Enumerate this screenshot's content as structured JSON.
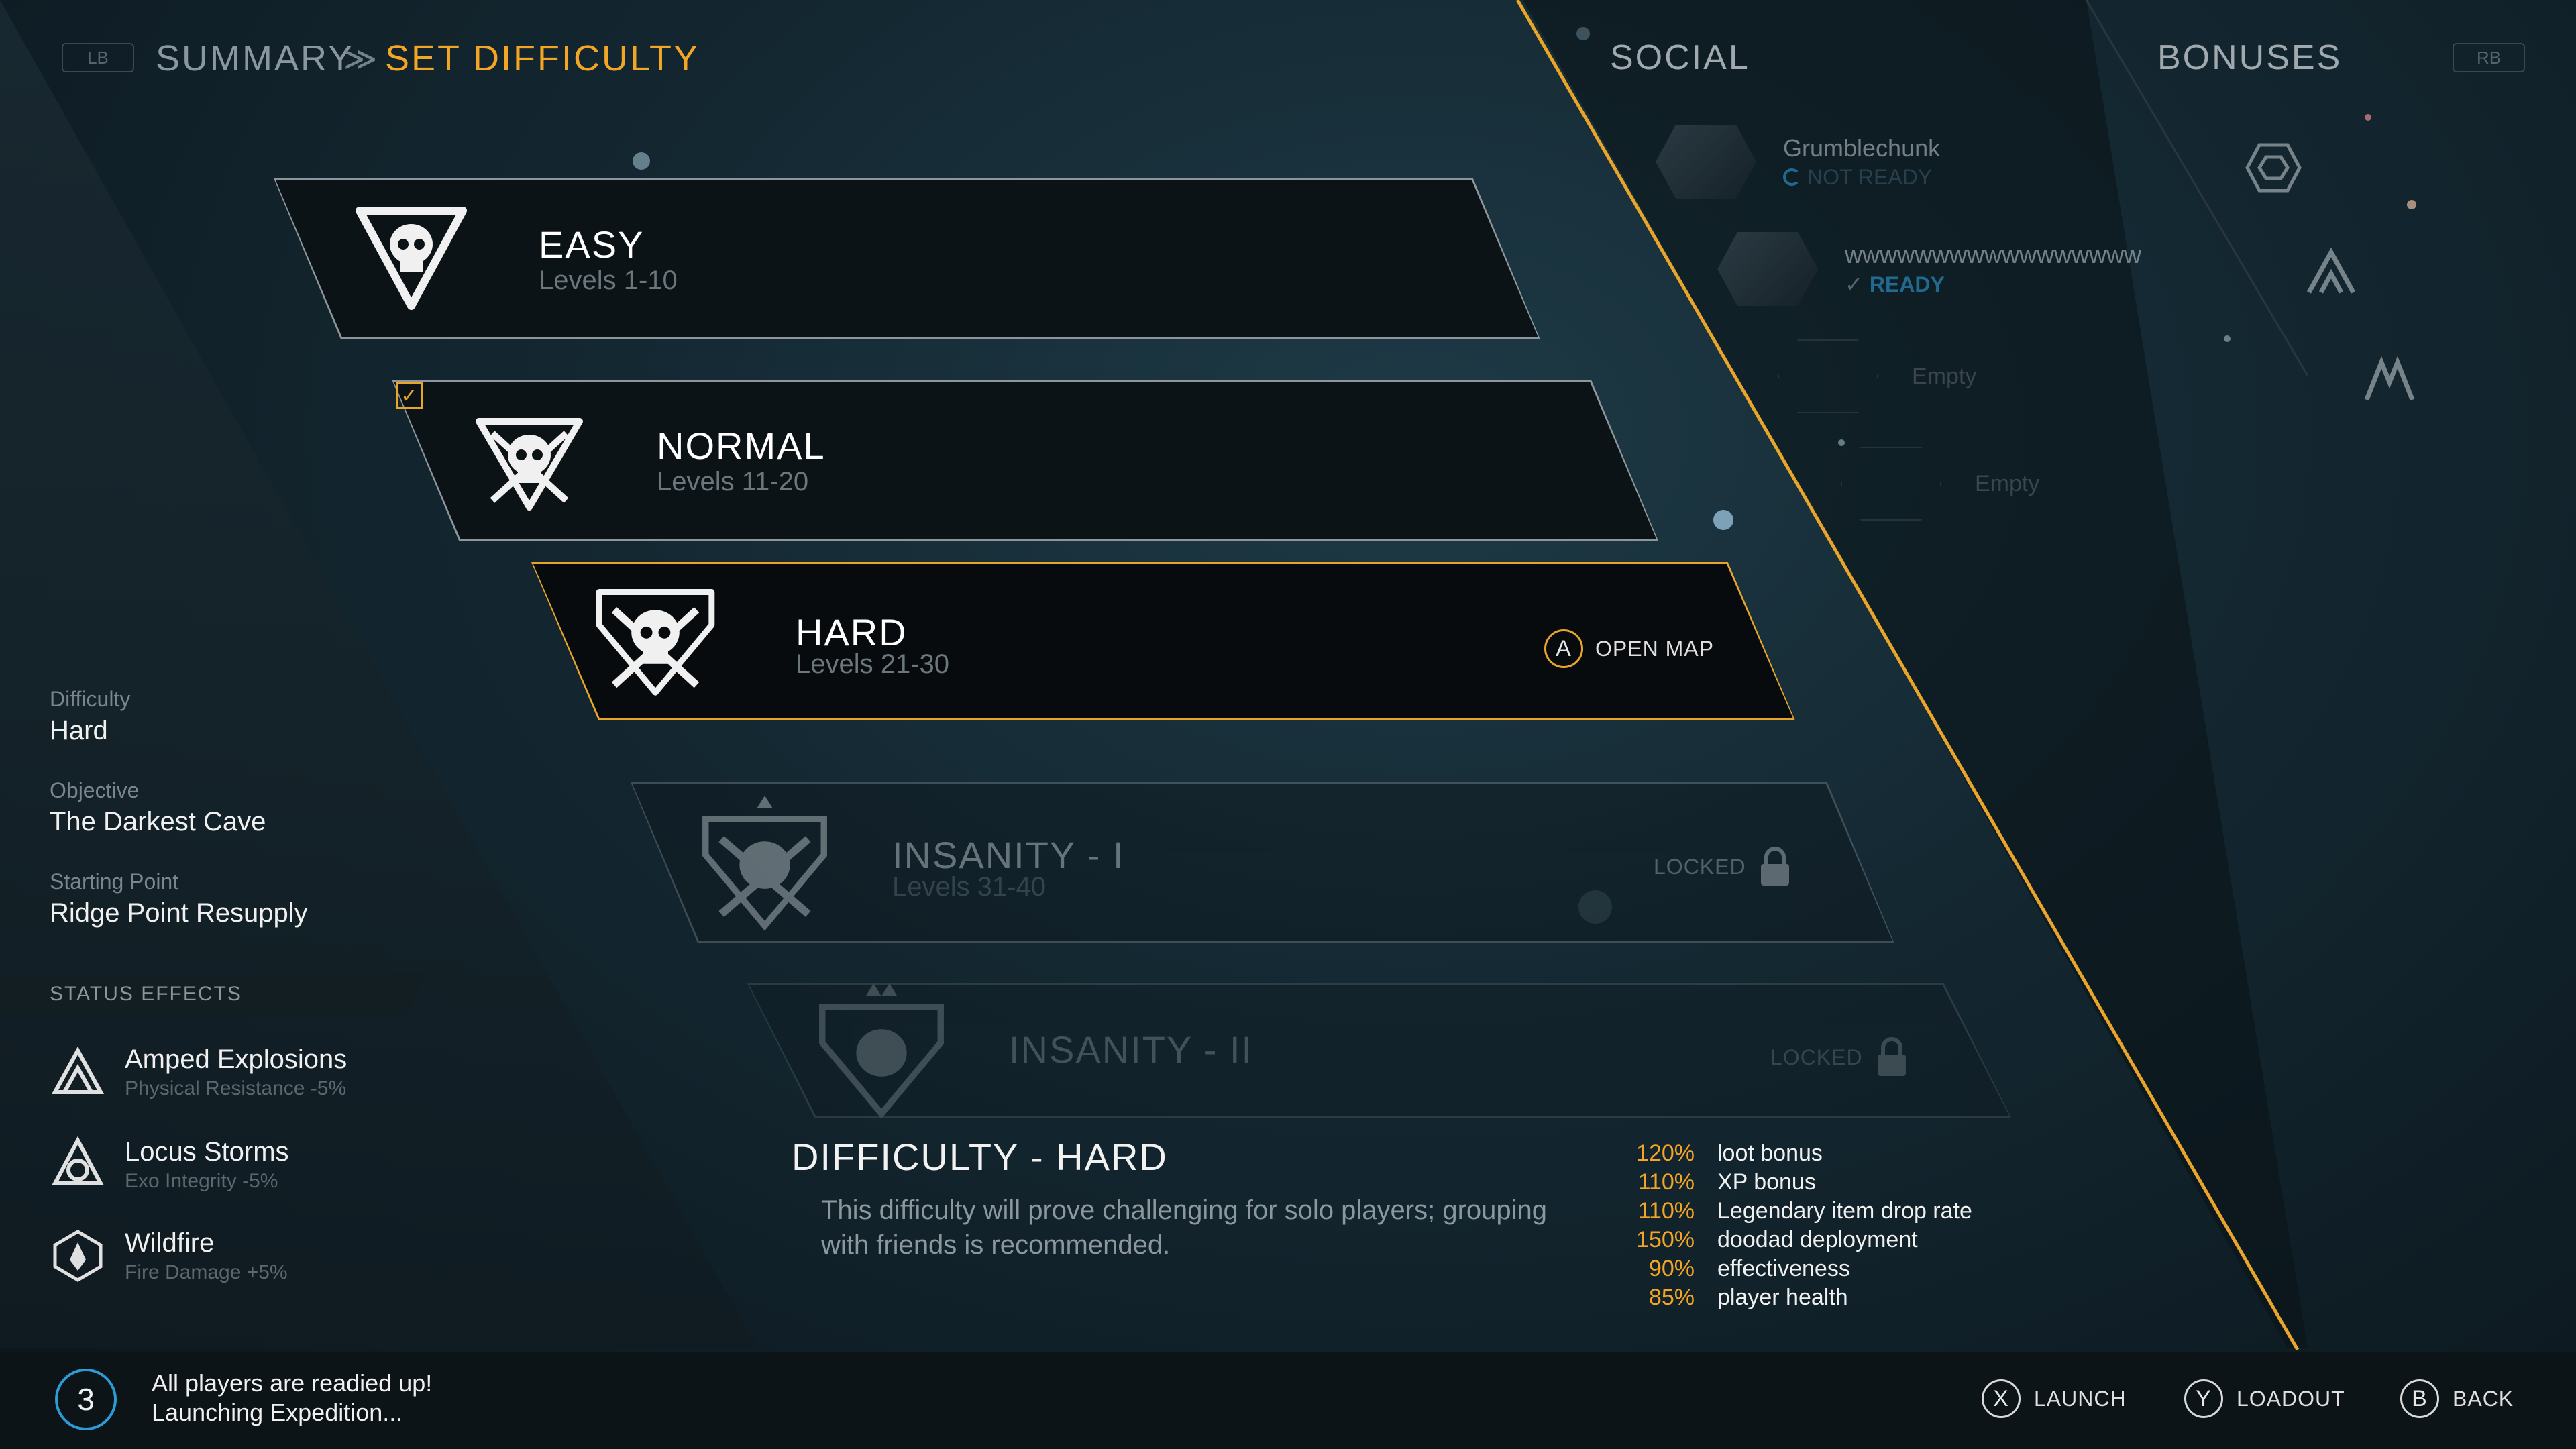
{
  "header": {
    "lb": "LB",
    "rb": "RB",
    "breadcrumb_prev": "SUMMARY",
    "breadcrumb_current": "SET DIFFICULTY",
    "tab_social": "SOCIAL",
    "tab_bonuses": "BONUSES"
  },
  "difficulties": [
    {
      "title": "EASY",
      "levels": "Levels 1-10",
      "state": "normal"
    },
    {
      "title": "NORMAL",
      "levels": "Levels 11-20",
      "state": "completed"
    },
    {
      "title": "HARD",
      "levels": "Levels 21-30",
      "state": "selected",
      "action_button": "A",
      "action_label": "OPEN MAP"
    },
    {
      "title": "INSANITY - I",
      "levels": "Levels 31-40",
      "state": "locked",
      "locked_label": "LOCKED"
    },
    {
      "title": "INSANITY - II",
      "levels": "",
      "state": "locked",
      "locked_label": "LOCKED"
    }
  ],
  "info": {
    "difficulty_label": "Difficulty",
    "difficulty_value": "Hard",
    "objective_label": "Objective",
    "objective_value": "The Darkest Cave",
    "starting_label": "Starting Point",
    "starting_value": "Ridge Point Resupply"
  },
  "status_effects": {
    "header": "STATUS EFFECTS",
    "items": [
      {
        "name": "Amped Explosions",
        "sub": "Physical Resistance -5%",
        "icon": "amped-explosions-icon"
      },
      {
        "name": "Locus Storms",
        "sub": "Exo Integrity -5%",
        "icon": "locus-storms-icon"
      },
      {
        "name": "Wildfire",
        "sub": "Fire Damage +5%",
        "icon": "wildfire-icon"
      }
    ]
  },
  "social": {
    "members": [
      {
        "name": "Grumblechunk",
        "status": "NOT READY",
        "status_color": "#2d9bd6"
      },
      {
        "name": "wwwwwwwwwwwwwwwww",
        "status": "READY",
        "status_color": "#2d9bd6"
      }
    ],
    "empty_label": "Empty"
  },
  "description": {
    "title": "DIFFICULTY - HARD",
    "body": "This difficulty will prove challenging for solo players; grouping with friends is recommended.",
    "stats": [
      {
        "value": "120%",
        "label": "loot bonus"
      },
      {
        "value": "110%",
        "label": "XP bonus"
      },
      {
        "value": "110%",
        "label": "Legendary item drop rate"
      },
      {
        "value": "150%",
        "label": "doodad deployment"
      },
      {
        "value": "90%",
        "label": "effectiveness"
      },
      {
        "value": "85%",
        "label": "player health"
      }
    ]
  },
  "bottom": {
    "countdown": "3",
    "ready_line1": "All players are readied up!",
    "ready_line2": "Launching Expedition...",
    "buttons": [
      {
        "key": "X",
        "label": "LAUNCH"
      },
      {
        "key": "Y",
        "label": "LOADOUT"
      },
      {
        "key": "B",
        "label": "BACK"
      }
    ]
  },
  "colors": {
    "accent": "#f3a525",
    "ready_blue": "#2d9bd6",
    "background": "#142832"
  }
}
